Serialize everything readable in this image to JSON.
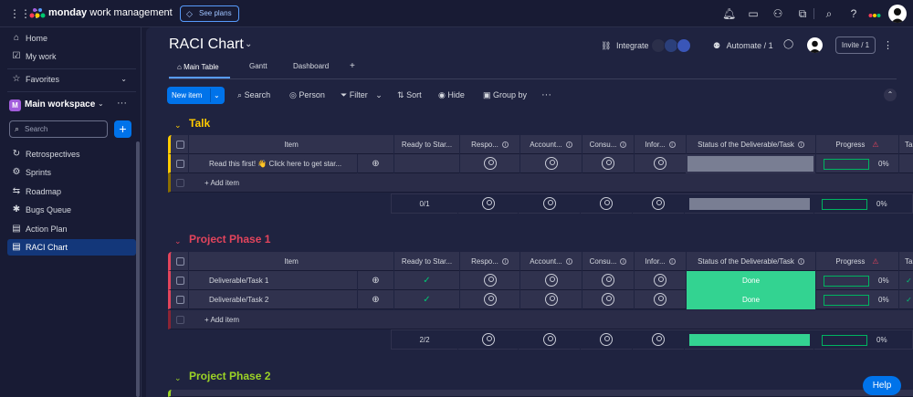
{
  "topbar": {
    "brand_bold": "monday",
    "brand_rest": " work management",
    "see_plans": "See plans",
    "icons": [
      "bell-icon",
      "inbox-icon",
      "invite-members-icon",
      "apps-icon",
      "search-icon",
      "help-icon"
    ]
  },
  "sidebar": {
    "home": "Home",
    "my_work": "My work",
    "favorites": "Favorites",
    "workspace_badge": "M",
    "workspace": "Main workspace",
    "search_placeholder": "Search",
    "items": [
      "Retrospectives",
      "Sprints",
      "Roadmap",
      "Bugs Queue",
      "Action Plan",
      "RACI Chart"
    ]
  },
  "board": {
    "title": "RACI Chart",
    "integrate": "Integrate",
    "automate": "Automate / 1",
    "invite": "Invite / 1",
    "tabs": [
      "Main Table",
      "Gantt",
      "Dashboard"
    ],
    "add_tab": "+",
    "new_item": "New item",
    "toolbar": [
      "Search",
      "Person",
      "Filter",
      "Sort",
      "Hide",
      "Group by"
    ],
    "more": "···"
  },
  "columns": [
    "Item",
    "Ready to Star...",
    "Respo...",
    "Account...",
    "Consu...",
    "Infor...",
    "Status of the Deliverable/Task",
    "Progress",
    "Tas"
  ],
  "groups": [
    {
      "name": "Talk",
      "color": "#ffcb00",
      "rows": [
        {
          "item": "Read this first! 👋 Click here to get star...",
          "ready": "",
          "status": "",
          "progress": "0%"
        }
      ],
      "add_item": "+ Add item",
      "summary_ready": "0/1",
      "summary_progress": "0%"
    },
    {
      "name": "Project Phase 1",
      "color": "#e2445c",
      "rows": [
        {
          "item": "Deliverable/Task 1",
          "ready": "✓",
          "status": "Done",
          "progress": "0%"
        },
        {
          "item": "Deliverable/Task 2",
          "ready": "✓",
          "status": "Done",
          "progress": "0%"
        }
      ],
      "add_item": "+ Add item",
      "summary_ready": "2/2",
      "summary_progress": "0%"
    },
    {
      "name": "Project Phase 2",
      "color": "#9cd326"
    }
  ],
  "help": "Help"
}
